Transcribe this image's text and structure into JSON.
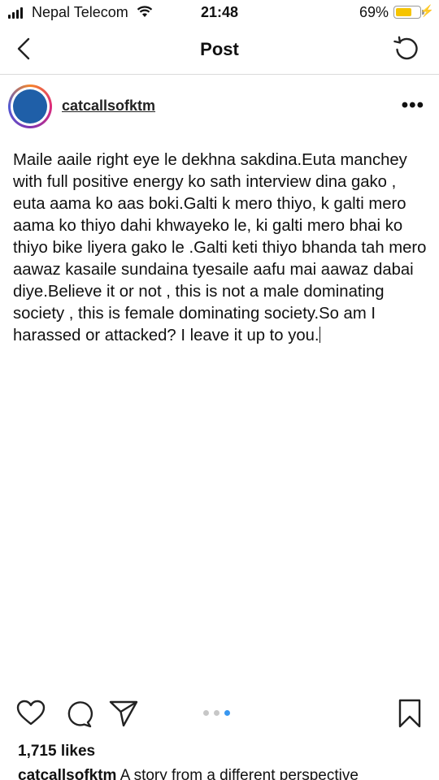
{
  "status_bar": {
    "carrier": "Nepal Telecom",
    "time": "21:48",
    "battery": "69%",
    "battery_level": 0.69,
    "battery_color": "#f6c400"
  },
  "nav": {
    "title": "Post",
    "back_icon": "chevron-left-icon",
    "refresh_icon": "refresh-icon"
  },
  "post": {
    "username": "catcallsofktm",
    "more_icon": "more-horizontal-icon",
    "text": "Maile aaile right eye le dekhna sakdina.Euta manchey with full positive energy ko sath interview dina gako , euta aama ko aas boki.Galti k mero thiyo, k galti mero aama ko thiyo dahi khwayeko le, ki galti mero bhai ko thiyo bike liyera gako le .Galti keti thiyo bhanda tah mero aawaz kasaile sundaina tyesaile aafu mai aawaz dabai diye.Believe it or not , this is not a male dominating society , this is female dominating society.So am I harassed or attacked? I leave it up to you."
  },
  "carousel": {
    "count": 3,
    "active_index": 2,
    "active_color": "#3897f0"
  },
  "footer": {
    "likes": "1,715 likes",
    "caption_user": "catcallsofktm",
    "caption_text": "A story from a different perspective"
  }
}
